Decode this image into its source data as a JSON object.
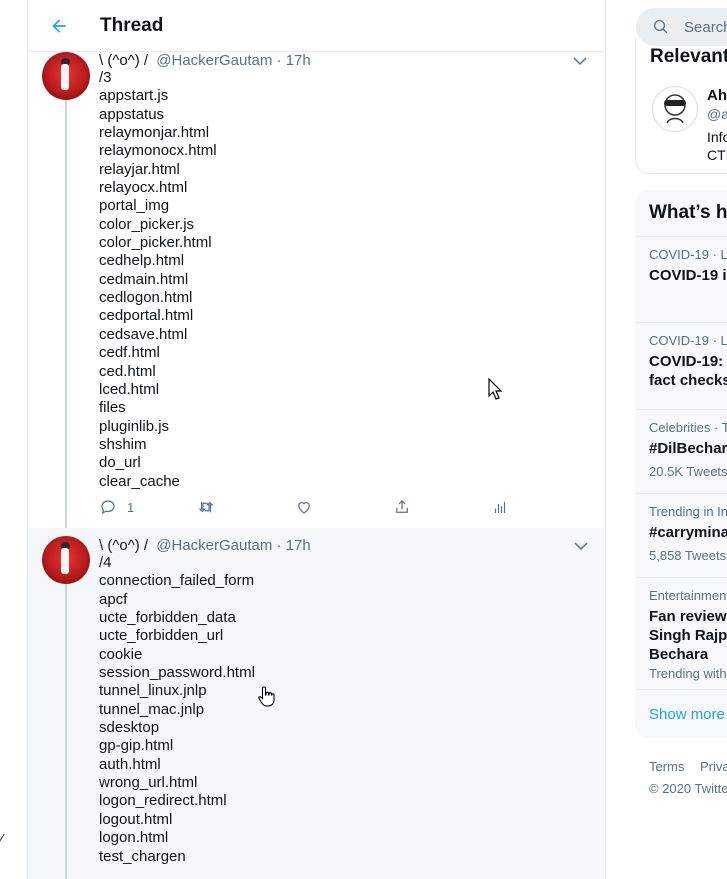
{
  "header": {
    "title": "Thread"
  },
  "tweets": [
    {
      "author": "\\ (^o^) /",
      "handle": "@HackerGautam",
      "time": "· 17h",
      "lines": [
        "/3",
        "appstart.js",
        "appstatus",
        "relaymonjar.html",
        "relaymonocx.html",
        "relayjar.html",
        "relayocx.html",
        "portal_img",
        "color_picker.js",
        "color_picker.html",
        "cedhelp.html",
        "cedmain.html",
        "cedlogon.html",
        "cedportal.html",
        "cedsave.html",
        "cedf.html",
        "ced.html",
        "lced.html",
        "files",
        "pluginlib.js",
        "shshim",
        "do_url",
        "clear_cache"
      ],
      "reply_count": "1"
    },
    {
      "author": "\\ (^o^) /",
      "handle": "@HackerGautam",
      "time": "· 17h",
      "lines": [
        "/4",
        "connection_failed_form",
        "apcf",
        "ucte_forbidden_data",
        "ucte_forbidden_url",
        "cookie",
        "session_password.html",
        "tunnel_linux.jnlp",
        "tunnel_mac.jnlp",
        "sdesktop",
        "gp-gip.html",
        "auth.html",
        "wrong_url.html",
        "logon_redirect.html",
        "logout.html",
        "logon.html",
        "test_chargen"
      ]
    }
  ],
  "sidebar": {
    "search_placeholder": "Search",
    "relevant_title": "Relevant",
    "relevant_name": "Ah",
    "relevant_handle": "@a",
    "relevant_bio_1": "Info",
    "relevant_bio_2": "CTI",
    "trends_title": "What’s h",
    "trends": [
      {
        "context": "COVID-19 · L",
        "name": "COVID-19 i",
        "sub": ""
      },
      {
        "context": "COVID-19 · L",
        "name": "COVID-19:",
        "name2": "fact checks",
        "sub": ""
      },
      {
        "context": "Celebrities · T",
        "name": "#DilBechar",
        "sub": "20.5K Tweets"
      },
      {
        "context": "Trending in In",
        "name": "#carrymina",
        "sub": "5,858 Tweets"
      },
      {
        "context": "Entertainment",
        "name": "Fan reviews",
        "name2": "Singh Rajpu",
        "name3": "Bechara",
        "sub": "Trending with"
      }
    ],
    "show_more": "Show more",
    "footer_terms": "Terms",
    "footer_privacy": "Privac",
    "footer_copyright": "© 2020 Twitte"
  },
  "colors": {
    "accent": "#1da1f2",
    "muted": "#5b7083",
    "hover_bg": "#f5f8fa"
  }
}
